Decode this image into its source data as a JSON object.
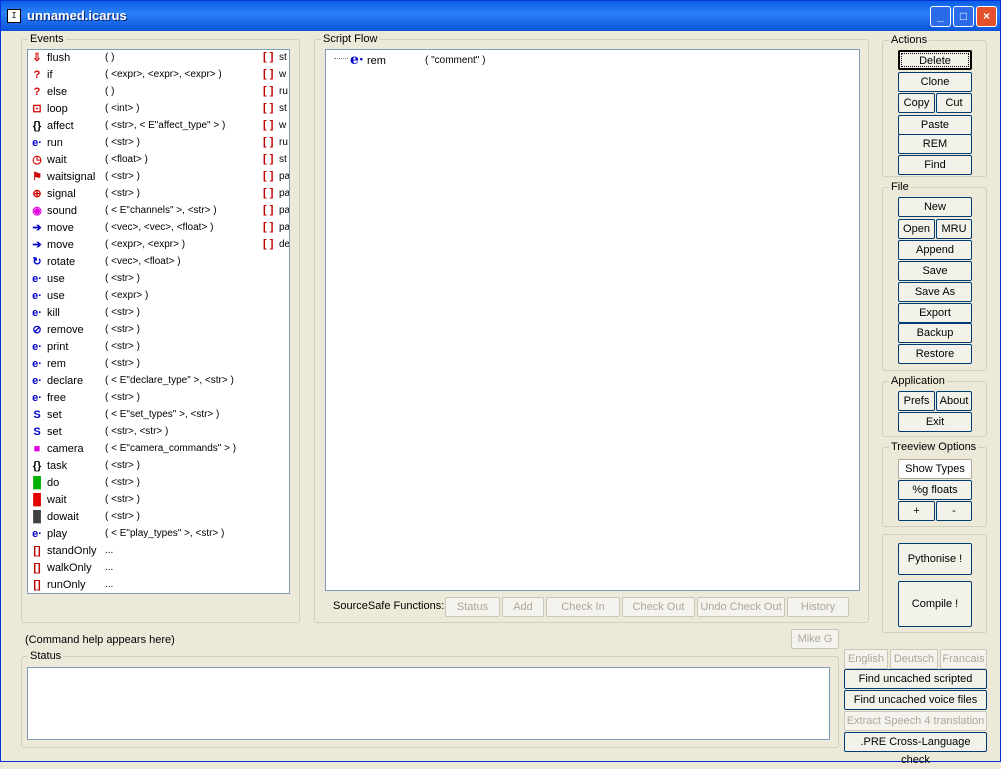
{
  "window": {
    "title": "unnamed.icarus",
    "app_icon": "icarus-app-icon",
    "controls": {
      "minimize": "_",
      "maximize": "□",
      "close": "×"
    }
  },
  "events": {
    "legend": "Events",
    "items": [
      {
        "icon": "flush-icon",
        "name": "flush",
        "params": "(   )",
        "right": "st"
      },
      {
        "icon": "if-icon",
        "name": "if",
        "params": "( <expr>, <expr>, <expr> )",
        "right": "w"
      },
      {
        "icon": "else-icon",
        "name": "else",
        "params": "(   )",
        "right": "ru"
      },
      {
        "icon": "loop-icon",
        "name": "loop",
        "params": "( <int> )",
        "right": "st"
      },
      {
        "icon": "braces-icon",
        "name": "affect",
        "params": "( <str>, < E\"affect_type\" > )",
        "right": "w"
      },
      {
        "icon": "e-icon",
        "name": "run",
        "params": "( <str> )",
        "right": "ru"
      },
      {
        "icon": "clock-icon",
        "name": "wait",
        "params": "( <float> )",
        "right": "st"
      },
      {
        "icon": "waitsignal-icon",
        "name": "waitsignal",
        "params": "( <str> )",
        "right": "pa"
      },
      {
        "icon": "signal-icon",
        "name": "signal",
        "params": "( <str> )",
        "right": "pa"
      },
      {
        "icon": "sound-icon",
        "name": "sound",
        "params": "( < E\"channels\" >, <str> )",
        "right": "pa"
      },
      {
        "icon": "arrow-right-icon",
        "name": "move",
        "params": "( <vec>, <vec>, <float> )",
        "right": "pa"
      },
      {
        "icon": "arrow-right-icon",
        "name": "move",
        "params": "( <expr>, <expr> )",
        "right": "de"
      },
      {
        "icon": "rotate-icon",
        "name": "rotate",
        "params": "( <vec>, <float> )",
        "right": ""
      },
      {
        "icon": "e-icon",
        "name": "use",
        "params": "( <str> )",
        "right": ""
      },
      {
        "icon": "e-icon",
        "name": "use",
        "params": "( <expr> )",
        "right": ""
      },
      {
        "icon": "e-icon",
        "name": "kill",
        "params": "( <str> )",
        "right": ""
      },
      {
        "icon": "remove-icon",
        "name": "remove",
        "params": "( <str> )",
        "right": ""
      },
      {
        "icon": "e-icon",
        "name": "print",
        "params": "( <str> )",
        "right": ""
      },
      {
        "icon": "e-icon",
        "name": "rem",
        "params": "( <str> )",
        "right": ""
      },
      {
        "icon": "e-icon",
        "name": "declare",
        "params": "( < E\"declare_type\" >, <str> )",
        "right": ""
      },
      {
        "icon": "e-icon",
        "name": "free",
        "params": "( <str> )",
        "right": ""
      },
      {
        "icon": "set-icon",
        "name": "set",
        "params": "( < E\"set_types\" >, <str> )",
        "right": ""
      },
      {
        "icon": "set-icon",
        "name": "set",
        "params": "( <str>, <str> )",
        "right": ""
      },
      {
        "icon": "camera-icon",
        "name": "camera",
        "params": "( < E\"camera_commands\" > )",
        "right": ""
      },
      {
        "icon": "braces-icon",
        "name": "task",
        "params": "( <str> )",
        "right": ""
      },
      {
        "icon": "do-icon",
        "name": "do",
        "params": "( <str> )",
        "right": ""
      },
      {
        "icon": "wait-red-icon",
        "name": "wait",
        "params": "( <str> )",
        "right": ""
      },
      {
        "icon": "dowait-icon",
        "name": "dowait",
        "params": "( <str> )",
        "right": ""
      },
      {
        "icon": "e-icon",
        "name": "play",
        "params": "( < E\"play_types\" >, <str> )",
        "right": ""
      },
      {
        "icon": "bracket-icon",
        "name": "standOnly",
        "params": "...",
        "right": ""
      },
      {
        "icon": "bracket-icon",
        "name": "walkOnly",
        "params": "...",
        "right": ""
      },
      {
        "icon": "bracket-icon",
        "name": "runOnly",
        "params": "...",
        "right": ""
      }
    ],
    "bracket_glyph": "[ ]"
  },
  "script_flow": {
    "legend": "Script Flow",
    "nodes": [
      {
        "icon": "e-icon",
        "name": "rem",
        "params": "( \"comment\" )"
      }
    ]
  },
  "sourcesafe": {
    "label": "SourceSafe Functions:",
    "buttons": [
      "Status",
      "Add",
      "Check In",
      "Check Out",
      "Undo Check Out",
      "History"
    ]
  },
  "actions": {
    "legend": "Actions",
    "delete": "Delete",
    "clone": "Clone",
    "copy": "Copy",
    "cut": "Cut",
    "paste": "Paste",
    "rem": "REM",
    "find": "Find"
  },
  "file": {
    "legend": "File",
    "new": "New",
    "open": "Open",
    "mru": "MRU",
    "append": "Append",
    "save": "Save",
    "save_as": "Save As",
    "export": "Export",
    "backup": "Backup",
    "restore": "Restore"
  },
  "application": {
    "legend": "Application",
    "prefs": "Prefs",
    "about": "About",
    "exit": "Exit"
  },
  "treeview": {
    "legend": "Treeview Options",
    "show_types": "Show Types",
    "g_floats": "%g floats",
    "plus": "+",
    "minus": "-"
  },
  "pythonise": "Pythonise !",
  "compile": "Compile !",
  "command_help": "(Command help appears here)",
  "mike": "Mike G",
  "status": {
    "legend": "Status"
  },
  "languages": [
    "English",
    "Deutsch",
    "Francais"
  ],
  "tools": {
    "find_audio": "Find uncached scripted audio",
    "find_voice": "Find uncached voice files",
    "extract": "Extract Speech 4 translation",
    "pre_check": ".PRE Cross-Language check"
  }
}
